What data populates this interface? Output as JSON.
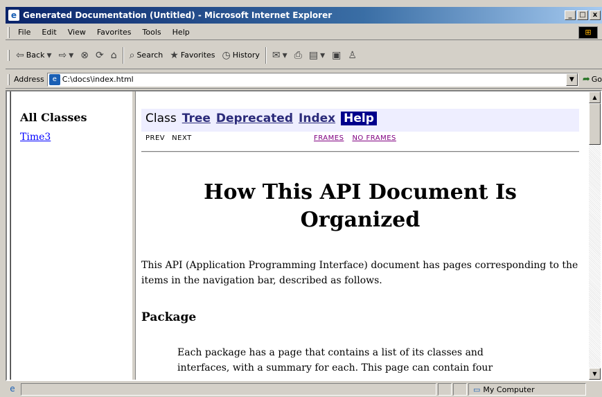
{
  "window": {
    "title": "Generated Documentation (Untitled) - Microsoft Internet Explorer",
    "minimize_label": "_",
    "maximize_label": "□",
    "close_label": "x"
  },
  "menu": {
    "items": [
      "File",
      "Edit",
      "View",
      "Favorites",
      "Tools",
      "Help"
    ]
  },
  "toolbar": {
    "back_label": "Back",
    "search_label": "Search",
    "favorites_label": "Favorites",
    "history_label": "History"
  },
  "address": {
    "label": "Address",
    "value": "C:\\docs\\index.html",
    "go_label": "Go"
  },
  "left_frame": {
    "heading": "All Classes",
    "classes": [
      "Time3"
    ]
  },
  "nav": {
    "class_label": "Class",
    "tree_label": "Tree",
    "deprecated_label": "Deprecated",
    "index_label": "Index",
    "help_label": "Help",
    "prev_label": "PREV",
    "next_label": "NEXT",
    "frames_label": "FRAMES",
    "no_frames_label": "NO FRAMES"
  },
  "document": {
    "title": "How This API Document Is Organized",
    "intro": "This API (Application Programming Interface) document has pages corresponding to the items in the navigation bar, described as follows.",
    "section_heading": "Package",
    "section_text": "Each package has a page that contains a list of its classes and interfaces, with a summary for each. This page can contain four"
  },
  "status": {
    "zone_label": "My Computer"
  }
}
